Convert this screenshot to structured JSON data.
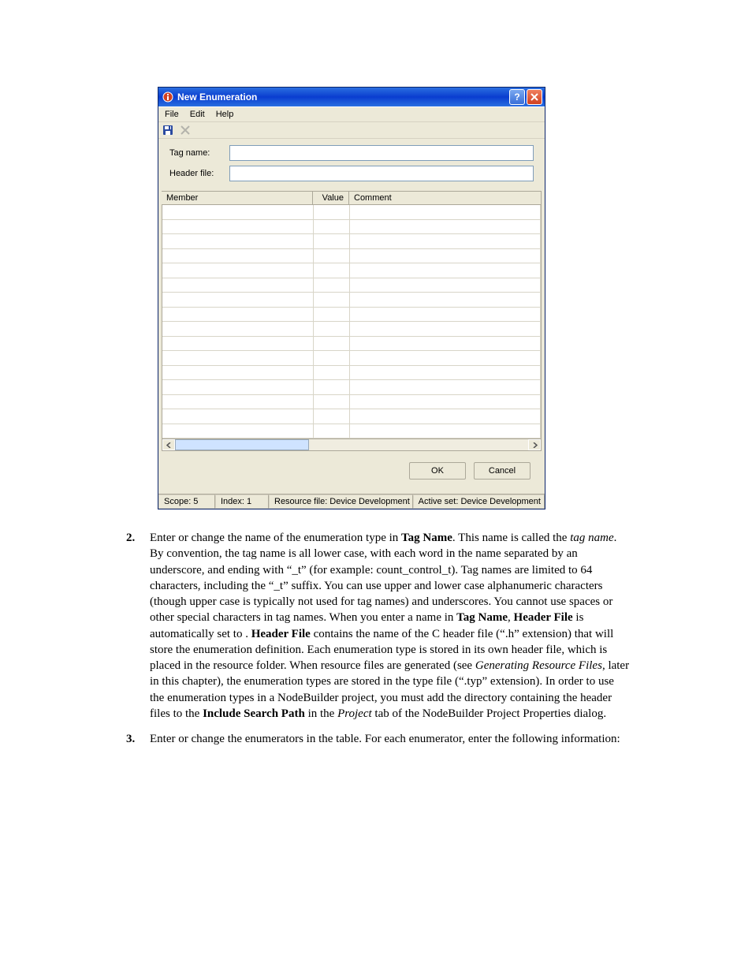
{
  "dialog": {
    "title": "New Enumeration",
    "menus": {
      "file": "File",
      "edit": "Edit",
      "help": "Help"
    },
    "toolbar": {
      "save_name": "save-icon",
      "delete_name": "delete-icon"
    },
    "form": {
      "tag_label": "Tag name:",
      "tag_value": "",
      "header_label": "Header file:",
      "header_value": ""
    },
    "grid": {
      "headers": {
        "member": "Member",
        "value": "Value",
        "comment": "Comment"
      }
    },
    "buttons": {
      "ok": "OK",
      "cancel": "Cancel"
    },
    "status": {
      "scope": "Scope: 5",
      "index": "Index: 1",
      "resource": "Resource file: Device Development",
      "active": "Active set: Device Development"
    }
  },
  "instructions": {
    "step2": {
      "num": "2.",
      "t1": "Enter or change the name of the enumeration type in ",
      "b1": "Tag Name",
      "t2": ".  This name is called the ",
      "i1": "tag name",
      "t3": ".  By convention, the tag name is all lower case, with each word in the name separated by an underscore, and ending with “_t” (for example: count_control_t).  Tag names are limited to 64 characters, including the “_t” suffix.  You can use upper and lower case alphanumeric characters (though upper case is typically not used for tag names) and underscores.  You cannot use spaces or other special characters in tag names.  When you enter a name in ",
      "b2": "Tag Name",
      "t4": ", ",
      "b3": "Header File",
      "t5": " is automatically set to ",
      "t6": ".  ",
      "b4": "Header File",
      "t7": " contains the name of the C header file (“.h” extension) that will store the enumeration definition.  Each enumeration type is stored in its own header file, which is placed in the resource folder.  When resource files are generated (see ",
      "i2": "Generating Resource Files",
      "t8": ", later in this chapter), the enumeration types are stored in the type file (“.typ” extension).  In order to use the enumeration types in a NodeBuilder project, you must add the directory containing the header files to the ",
      "b5": "Include Search Path",
      "t9": " in the ",
      "i3": "Project",
      "t10": " tab of the NodeBuilder Project Properties dialog."
    },
    "step3": {
      "num": "3.",
      "t1": "Enter or change the enumerators in the table.  For each enumerator, enter the following information:"
    }
  }
}
